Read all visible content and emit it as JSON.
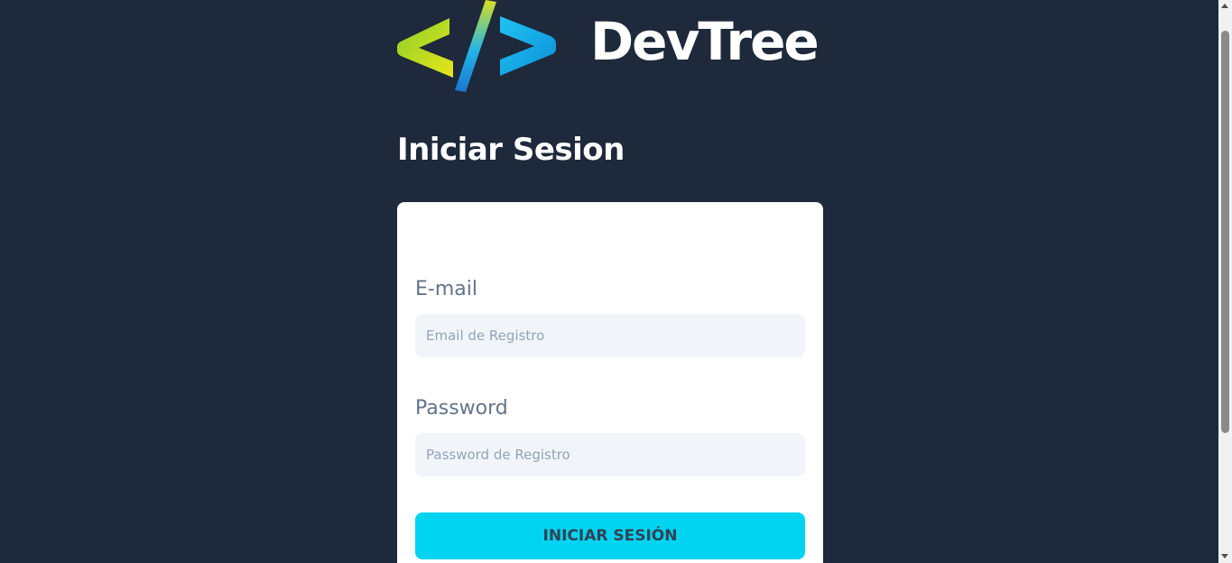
{
  "brand": {
    "name": "DevTree",
    "colors": {
      "lime": "#b8e02c",
      "cyan": "#14b8e6",
      "background": "#1e293b"
    }
  },
  "title": "Iniciar Sesion",
  "form": {
    "email_label": "E-mail",
    "email_placeholder": "Email de Registro",
    "email_value": "",
    "password_label": "Password",
    "password_placeholder": "Password de Registro",
    "password_value": "",
    "submit_label": "INICIAR SESIÓN",
    "submit_color": "#00d4f0"
  },
  "icons": {
    "logo": "code-brackets-icon"
  }
}
